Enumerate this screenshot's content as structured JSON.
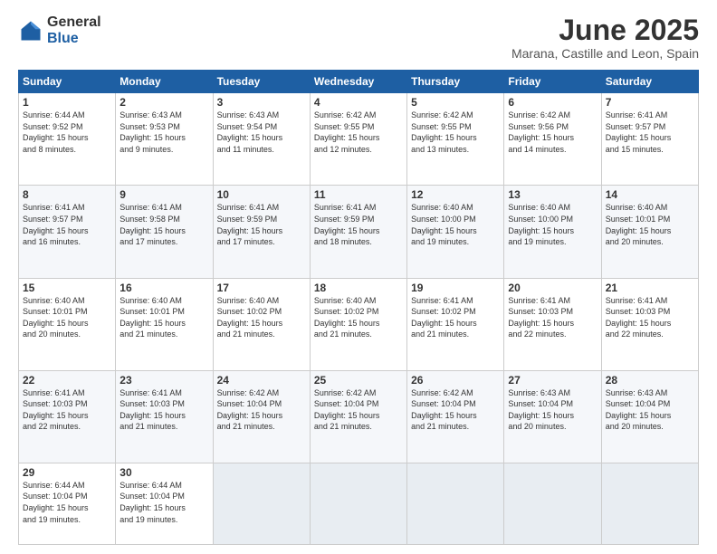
{
  "header": {
    "logo_general": "General",
    "logo_blue": "Blue",
    "title": "June 2025",
    "subtitle": "Marana, Castille and Leon, Spain"
  },
  "weekdays": [
    "Sunday",
    "Monday",
    "Tuesday",
    "Wednesday",
    "Thursday",
    "Friday",
    "Saturday"
  ],
  "weeks": [
    [
      {
        "day": "1",
        "sunrise": "6:44 AM",
        "sunset": "9:52 PM",
        "daylight": "15 hours and 8 minutes."
      },
      {
        "day": "2",
        "sunrise": "6:43 AM",
        "sunset": "9:53 PM",
        "daylight": "15 hours and 9 minutes."
      },
      {
        "day": "3",
        "sunrise": "6:43 AM",
        "sunset": "9:54 PM",
        "daylight": "15 hours and 11 minutes."
      },
      {
        "day": "4",
        "sunrise": "6:42 AM",
        "sunset": "9:55 PM",
        "daylight": "15 hours and 12 minutes."
      },
      {
        "day": "5",
        "sunrise": "6:42 AM",
        "sunset": "9:55 PM",
        "daylight": "15 hours and 13 minutes."
      },
      {
        "day": "6",
        "sunrise": "6:42 AM",
        "sunset": "9:56 PM",
        "daylight": "15 hours and 14 minutes."
      },
      {
        "day": "7",
        "sunrise": "6:41 AM",
        "sunset": "9:57 PM",
        "daylight": "15 hours and 15 minutes."
      }
    ],
    [
      {
        "day": "8",
        "sunrise": "6:41 AM",
        "sunset": "9:57 PM",
        "daylight": "15 hours and 16 minutes."
      },
      {
        "day": "9",
        "sunrise": "6:41 AM",
        "sunset": "9:58 PM",
        "daylight": "15 hours and 17 minutes."
      },
      {
        "day": "10",
        "sunrise": "6:41 AM",
        "sunset": "9:59 PM",
        "daylight": "15 hours and 17 minutes."
      },
      {
        "day": "11",
        "sunrise": "6:41 AM",
        "sunset": "9:59 PM",
        "daylight": "15 hours and 18 minutes."
      },
      {
        "day": "12",
        "sunrise": "6:40 AM",
        "sunset": "10:00 PM",
        "daylight": "15 hours and 19 minutes."
      },
      {
        "day": "13",
        "sunrise": "6:40 AM",
        "sunset": "10:00 PM",
        "daylight": "15 hours and 19 minutes."
      },
      {
        "day": "14",
        "sunrise": "6:40 AM",
        "sunset": "10:01 PM",
        "daylight": "15 hours and 20 minutes."
      }
    ],
    [
      {
        "day": "15",
        "sunrise": "6:40 AM",
        "sunset": "10:01 PM",
        "daylight": "15 hours and 20 minutes."
      },
      {
        "day": "16",
        "sunrise": "6:40 AM",
        "sunset": "10:01 PM",
        "daylight": "15 hours and 21 minutes."
      },
      {
        "day": "17",
        "sunrise": "6:40 AM",
        "sunset": "10:02 PM",
        "daylight": "15 hours and 21 minutes."
      },
      {
        "day": "18",
        "sunrise": "6:40 AM",
        "sunset": "10:02 PM",
        "daylight": "15 hours and 21 minutes."
      },
      {
        "day": "19",
        "sunrise": "6:41 AM",
        "sunset": "10:02 PM",
        "daylight": "15 hours and 21 minutes."
      },
      {
        "day": "20",
        "sunrise": "6:41 AM",
        "sunset": "10:03 PM",
        "daylight": "15 hours and 22 minutes."
      },
      {
        "day": "21",
        "sunrise": "6:41 AM",
        "sunset": "10:03 PM",
        "daylight": "15 hours and 22 minutes."
      }
    ],
    [
      {
        "day": "22",
        "sunrise": "6:41 AM",
        "sunset": "10:03 PM",
        "daylight": "15 hours and 22 minutes."
      },
      {
        "day": "23",
        "sunrise": "6:41 AM",
        "sunset": "10:03 PM",
        "daylight": "15 hours and 21 minutes."
      },
      {
        "day": "24",
        "sunrise": "6:42 AM",
        "sunset": "10:04 PM",
        "daylight": "15 hours and 21 minutes."
      },
      {
        "day": "25",
        "sunrise": "6:42 AM",
        "sunset": "10:04 PM",
        "daylight": "15 hours and 21 minutes."
      },
      {
        "day": "26",
        "sunrise": "6:42 AM",
        "sunset": "10:04 PM",
        "daylight": "15 hours and 21 minutes."
      },
      {
        "day": "27",
        "sunrise": "6:43 AM",
        "sunset": "10:04 PM",
        "daylight": "15 hours and 20 minutes."
      },
      {
        "day": "28",
        "sunrise": "6:43 AM",
        "sunset": "10:04 PM",
        "daylight": "15 hours and 20 minutes."
      }
    ],
    [
      {
        "day": "29",
        "sunrise": "6:44 AM",
        "sunset": "10:04 PM",
        "daylight": "15 hours and 19 minutes."
      },
      {
        "day": "30",
        "sunrise": "6:44 AM",
        "sunset": "10:04 PM",
        "daylight": "15 hours and 19 minutes."
      },
      null,
      null,
      null,
      null,
      null
    ]
  ]
}
